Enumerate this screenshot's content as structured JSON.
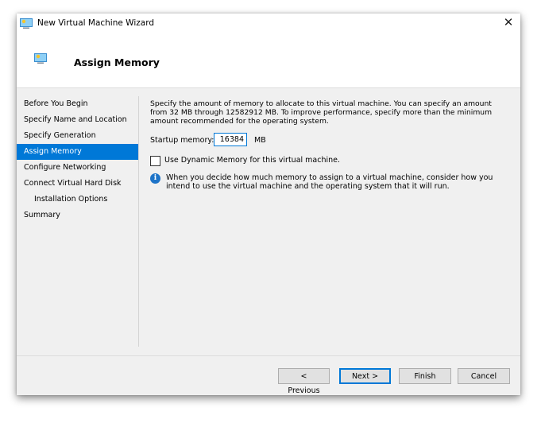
{
  "window": {
    "title": "New Virtual Machine Wizard",
    "close_symbol": "✕"
  },
  "header": {
    "title": "Assign Memory",
    "icon": "virtual-machine-icon"
  },
  "nav": {
    "items": [
      {
        "label": "Before You Begin",
        "active": false,
        "sub": false
      },
      {
        "label": "Specify Name and Location",
        "active": false,
        "sub": false
      },
      {
        "label": "Specify Generation",
        "active": false,
        "sub": false
      },
      {
        "label": "Assign Memory",
        "active": true,
        "sub": false
      },
      {
        "label": "Configure Networking",
        "active": false,
        "sub": false
      },
      {
        "label": "Connect Virtual Hard Disk",
        "active": false,
        "sub": false
      },
      {
        "label": "Installation Options",
        "active": false,
        "sub": true
      },
      {
        "label": "Summary",
        "active": false,
        "sub": false
      }
    ]
  },
  "content": {
    "description": "Specify the amount of memory to allocate to this virtual machine. You can specify an amount from 32 MB through 12582912 MB. To improve performance, specify more than the minimum amount recommended for the operating system.",
    "startup_memory_label": "Startup memory:",
    "startup_memory_value": "16384",
    "startup_memory_unit": "MB",
    "dynamic_memory_label": "Use Dynamic Memory for this virtual machine.",
    "dynamic_memory_checked": false,
    "info_text": "When you decide how much memory to assign to a virtual machine, consider how you intend to use the virtual machine and the operating system that it will run."
  },
  "buttons": {
    "previous": "< Previous",
    "next": "Next >",
    "finish": "Finish",
    "cancel": "Cancel"
  },
  "colors": {
    "accent": "#0078d7",
    "info": "#1e74c8"
  }
}
